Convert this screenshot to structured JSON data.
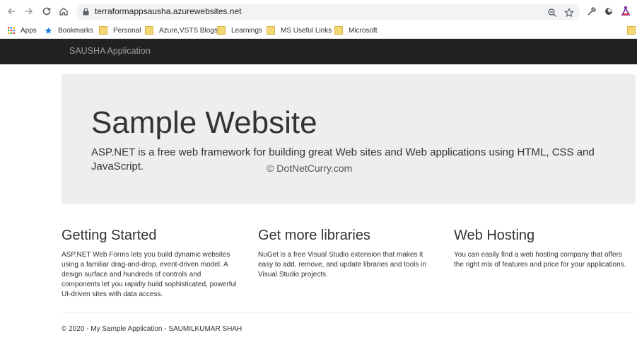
{
  "browser": {
    "url": "terraformappsausha.azurewebsites.net"
  },
  "bookmarks": [
    {
      "label": "Apps",
      "icon": "apps-grid-icon"
    },
    {
      "label": "Bookmarks",
      "icon": "star-icon"
    },
    {
      "label": "Personal",
      "icon": "folder-icon"
    },
    {
      "label": "Azure,VSTS Blogs",
      "icon": "folder-icon"
    },
    {
      "label": "Learnings",
      "icon": "folder-icon"
    },
    {
      "label": "MS Useful Links",
      "icon": "folder-icon"
    },
    {
      "label": "Microsoft",
      "icon": "folder-icon"
    }
  ],
  "site": {
    "brand": "SAUSHA Application",
    "jumbotron": {
      "title": "Sample Website",
      "lead": "ASP.NET is a free web framework for building great Web sites and Web applications using HTML, CSS and JavaScript."
    },
    "watermark": "© DotNetCurry.com",
    "columns": [
      {
        "heading": "Getting Started",
        "text": "ASP.NET Web Forms lets you build dynamic websites using a familiar drag-and-drop, event-driven model. A design surface and hundreds of controls and components let you rapidly build sophisticated, powerful UI-driven sites with data access."
      },
      {
        "heading": "Get more libraries",
        "text": "NuGet is a free Visual Studio extension that makes it easy to add, remove, and update libraries and tools in Visual Studio projects."
      },
      {
        "heading": "Web Hosting",
        "text": "You can easily find a web hosting company that offers the right mix of features and price for your applications."
      }
    ],
    "footer": "© 2020 - My Sample Application - SAUMILKUMAR SHAH"
  },
  "colors": {
    "navbar_bg": "#222222",
    "jumbotron_bg": "#eeeeee",
    "brand_text": "#9d9d9d"
  }
}
